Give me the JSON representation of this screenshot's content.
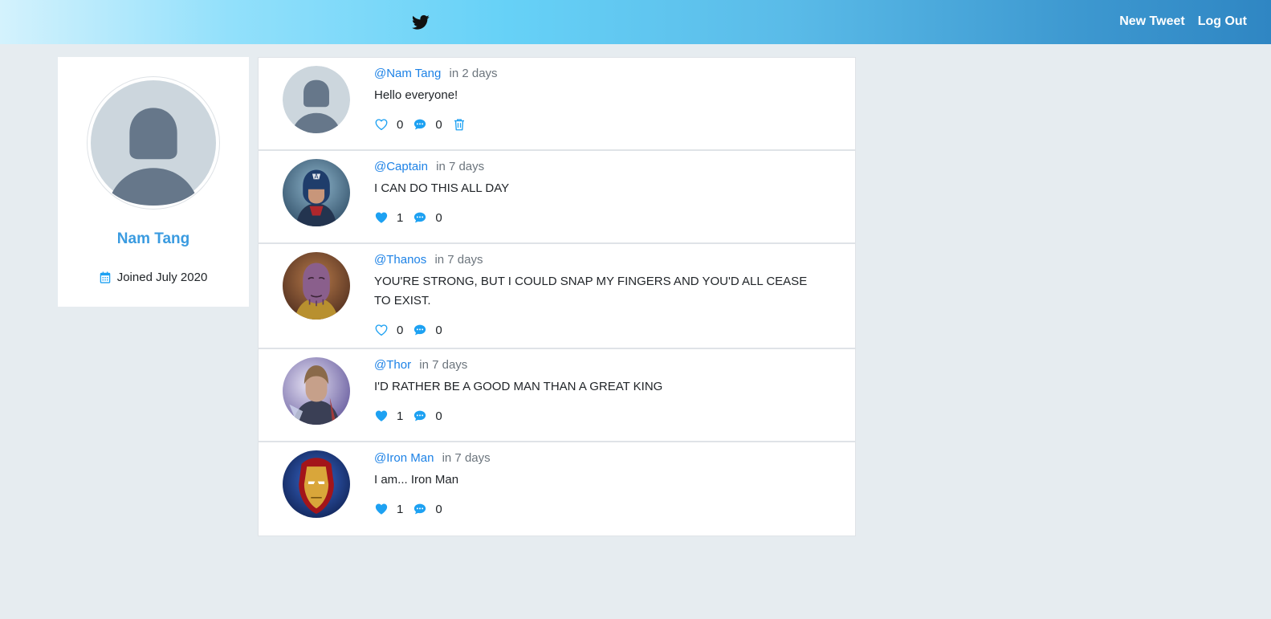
{
  "nav": {
    "new_tweet": "New Tweet",
    "log_out": "Log Out"
  },
  "profile": {
    "name": "Nam Tang",
    "joined": "Joined July 2020"
  },
  "colors": {
    "accent": "#1da1f2",
    "link": "#1d82e6",
    "name": "#3a9be0"
  },
  "tweets": [
    {
      "handle": "@Nam Tang",
      "time": "in 2 days",
      "text": "Hello everyone!",
      "likes": "0",
      "comments": "0",
      "liked": false,
      "deletable": true,
      "avatar": "default-user"
    },
    {
      "handle": "@Captain",
      "time": "in 7 days",
      "text": "I CAN DO THIS ALL DAY",
      "likes": "1",
      "comments": "0",
      "liked": true,
      "deletable": false,
      "avatar": "captain"
    },
    {
      "handle": "@Thanos",
      "time": "in 7 days",
      "text": "YOU'RE STRONG, BUT I COULD SNAP MY FINGERS AND YOU'D ALL CEASE TO EXIST.",
      "likes": "0",
      "comments": "0",
      "liked": false,
      "deletable": false,
      "avatar": "thanos"
    },
    {
      "handle": "@Thor",
      "time": "in 7 days",
      "text": "I'D RATHER BE A GOOD MAN THAN A GREAT KING",
      "likes": "1",
      "comments": "0",
      "liked": true,
      "deletable": false,
      "avatar": "thor"
    },
    {
      "handle": "@Iron Man",
      "time": "in 7 days",
      "text": "I am... Iron Man",
      "likes": "1",
      "comments": "0",
      "liked": true,
      "deletable": false,
      "avatar": "iron-man"
    }
  ]
}
